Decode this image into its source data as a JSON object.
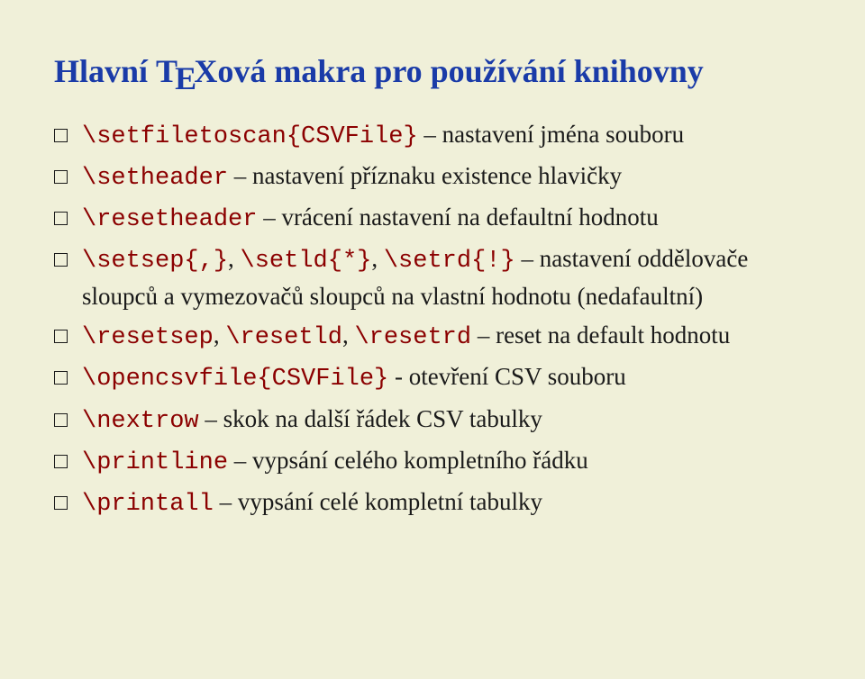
{
  "title_prefix": "Hlavní ",
  "title_tex": "TEX",
  "title_suffix": "ová makra pro používání knihovny",
  "items": [
    {
      "cmd1": "\\setfiletoscan{CSVFile}",
      "sep1": " – ",
      "txt1": "nastavení jména souboru"
    },
    {
      "cmd1": "\\setheader",
      "sep1": " – ",
      "txt1": "nastavení příznaku existence hlavičky"
    },
    {
      "cmd1": "\\resetheader",
      "sep1": " – ",
      "txt1": "vrácení nastavení na defaultní hodnotu"
    },
    {
      "cmd1": "\\setsep{,}",
      "sep1": ", ",
      "cmd2": "\\setld{*}",
      "sep2": ", ",
      "cmd3": "\\setrd{!}",
      "sep3": " – ",
      "txt1": "nastavení oddělovače sloupců a vymezovačů sloupců na vlastní hodnotu (nedafaultní)"
    },
    {
      "cmd1": "\\resetsep",
      "sep1": ", ",
      "cmd2": "\\resetld",
      "sep2": ", ",
      "cmd3": "\\resetrd",
      "sep3": " – ",
      "txt1": "reset na default hodnotu"
    },
    {
      "cmd1": "\\opencsvfile{CSVFile}",
      "sep1": " - ",
      "txt1": "otevření CSV souboru"
    },
    {
      "cmd1": "\\nextrow",
      "sep1": " – ",
      "txt1": "skok na další řádek CSV tabulky"
    },
    {
      "cmd1": "\\printline",
      "sep1": " – ",
      "txt1": "vypsání celého kompletního řádku"
    },
    {
      "cmd1": "\\printall",
      "sep1": " – ",
      "txt1": "vypsání celé kompletní tabulky"
    }
  ]
}
